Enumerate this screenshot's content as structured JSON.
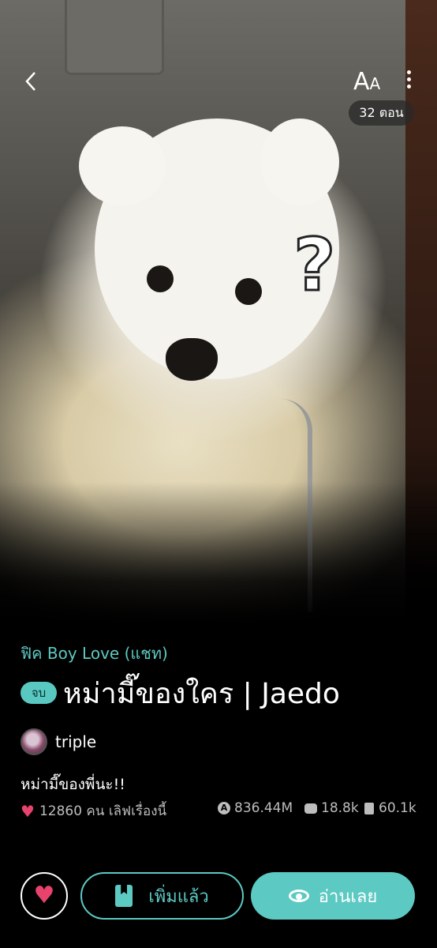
{
  "header": {
    "back_icon": "chevron-left-icon",
    "font_size_label_big": "A",
    "font_size_label_small": "A",
    "more_icon": "more-vertical-icon",
    "episodes": "32 ตอน"
  },
  "story": {
    "genre": "ฟิค Boy Love (แชท)",
    "status_badge": "จบ",
    "title": "หม่ามี๊ของใคร | Jaedo",
    "author": "triple",
    "description": "หม่ามี๊ของพี่นะ!!",
    "likes_text": "12860 คน เลิฟเรื่องนี้",
    "views": "836.44M",
    "comments": "18.8k",
    "saves": "60.1k"
  },
  "actions": {
    "added_label": "เพิ่มแล้ว",
    "read_label": "อ่านเลย"
  },
  "colors": {
    "accent": "#5cc9c2",
    "heart": "#e7436c",
    "background": "#000000"
  }
}
